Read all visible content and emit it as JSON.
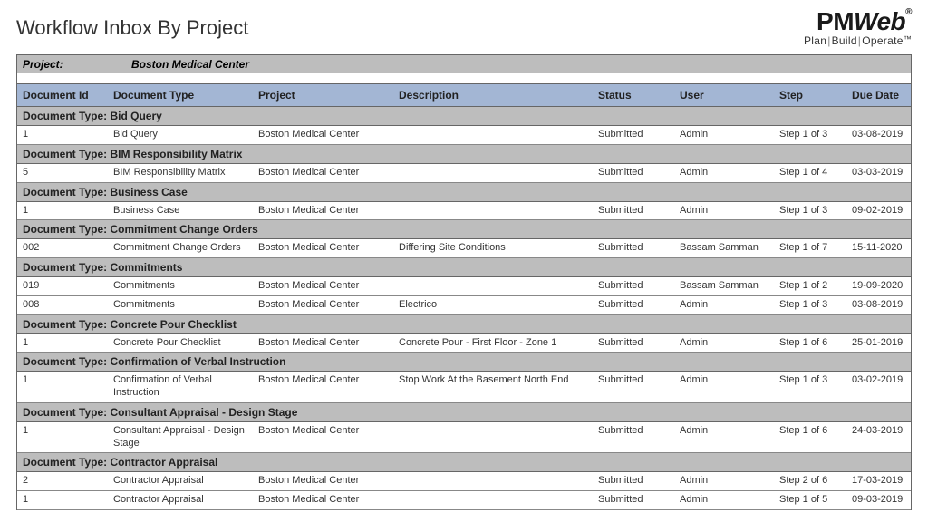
{
  "title": "Workflow Inbox By Project",
  "logo": {
    "brand_pm": "PM",
    "brand_w": "W",
    "brand_eb": "eb",
    "reg": "®",
    "tag_plan": "Plan",
    "tag_build": "Build",
    "tag_operate": "Operate",
    "tm": "™"
  },
  "project_label": "Project:",
  "project_value": "Boston Medical Center",
  "columns": {
    "doc_id": "Document Id",
    "doc_type": "Document Type",
    "project": "Project",
    "description": "Description",
    "status": "Status",
    "user": "User",
    "step": "Step",
    "due": "Due Date"
  },
  "groups": [
    {
      "header": "Document Type:  Bid Query",
      "rows": [
        {
          "id": "1",
          "type": "Bid Query",
          "project": "Boston Medical Center",
          "desc": "",
          "status": "Submitted",
          "user": "Admin",
          "step": "Step 1 of 3",
          "due": "03-08-2019"
        }
      ]
    },
    {
      "header": "Document Type:  BIM Responsibility Matrix",
      "rows": [
        {
          "id": "5",
          "type": "BIM Responsibility Matrix",
          "project": "Boston Medical Center",
          "desc": "",
          "status": "Submitted",
          "user": "Admin",
          "step": "Step 1 of 4",
          "due": "03-03-2019"
        }
      ]
    },
    {
      "header": "Document Type:  Business Case",
      "rows": [
        {
          "id": "1",
          "type": "Business Case",
          "project": "Boston Medical Center",
          "desc": "",
          "status": "Submitted",
          "user": "Admin",
          "step": "Step 1 of 3",
          "due": "09-02-2019"
        }
      ]
    },
    {
      "header": "Document Type:  Commitment Change Orders",
      "rows": [
        {
          "id": "002",
          "type": "Commitment Change Orders",
          "project": "Boston Medical Center",
          "desc": "Differing Site Conditions",
          "status": "Submitted",
          "user": "Bassam Samman",
          "step": "Step 1 of 7",
          "due": "15-11-2020"
        }
      ]
    },
    {
      "header": "Document Type:  Commitments",
      "rows": [
        {
          "id": "019",
          "type": "Commitments",
          "project": "Boston Medical Center",
          "desc": "",
          "status": "Submitted",
          "user": "Bassam Samman",
          "step": "Step 1 of 2",
          "due": "19-09-2020"
        },
        {
          "id": "008",
          "type": "Commitments",
          "project": "Boston Medical Center",
          "desc": "Electrico",
          "status": "Submitted",
          "user": "Admin",
          "step": "Step 1 of 3",
          "due": "03-08-2019"
        }
      ]
    },
    {
      "header": "Document Type:  Concrete Pour Checklist",
      "rows": [
        {
          "id": "1",
          "type": "Concrete Pour Checklist",
          "project": "Boston Medical Center",
          "desc": "Concrete Pour - First Floor - Zone 1",
          "status": "Submitted",
          "user": "Admin",
          "step": "Step 1 of 6",
          "due": "25-01-2019"
        }
      ]
    },
    {
      "header": "Document Type:  Confirmation of Verbal Instruction",
      "rows": [
        {
          "id": "1",
          "type": "Confirmation of Verbal Instruction",
          "project": "Boston Medical Center",
          "desc": "Stop Work At the Basement North End",
          "status": "Submitted",
          "user": "Admin",
          "step": "Step 1 of 3",
          "due": "03-02-2019"
        }
      ]
    },
    {
      "header": "Document Type:  Consultant Appraisal - Design Stage",
      "rows": [
        {
          "id": "1",
          "type": "Consultant Appraisal - Design Stage",
          "project": "Boston Medical Center",
          "desc": "",
          "status": "Submitted",
          "user": "Admin",
          "step": "Step 1 of 6",
          "due": "24-03-2019"
        }
      ]
    },
    {
      "header": "Document Type:  Contractor Appraisal",
      "rows": [
        {
          "id": "2",
          "type": "Contractor Appraisal",
          "project": "Boston Medical Center",
          "desc": "",
          "status": "Submitted",
          "user": "Admin",
          "step": "Step 2 of 6",
          "due": "17-03-2019"
        },
        {
          "id": "1",
          "type": "Contractor Appraisal",
          "project": "Boston Medical Center",
          "desc": "",
          "status": "Submitted",
          "user": "Admin",
          "step": "Step 1 of 5",
          "due": "09-03-2019"
        }
      ]
    }
  ]
}
